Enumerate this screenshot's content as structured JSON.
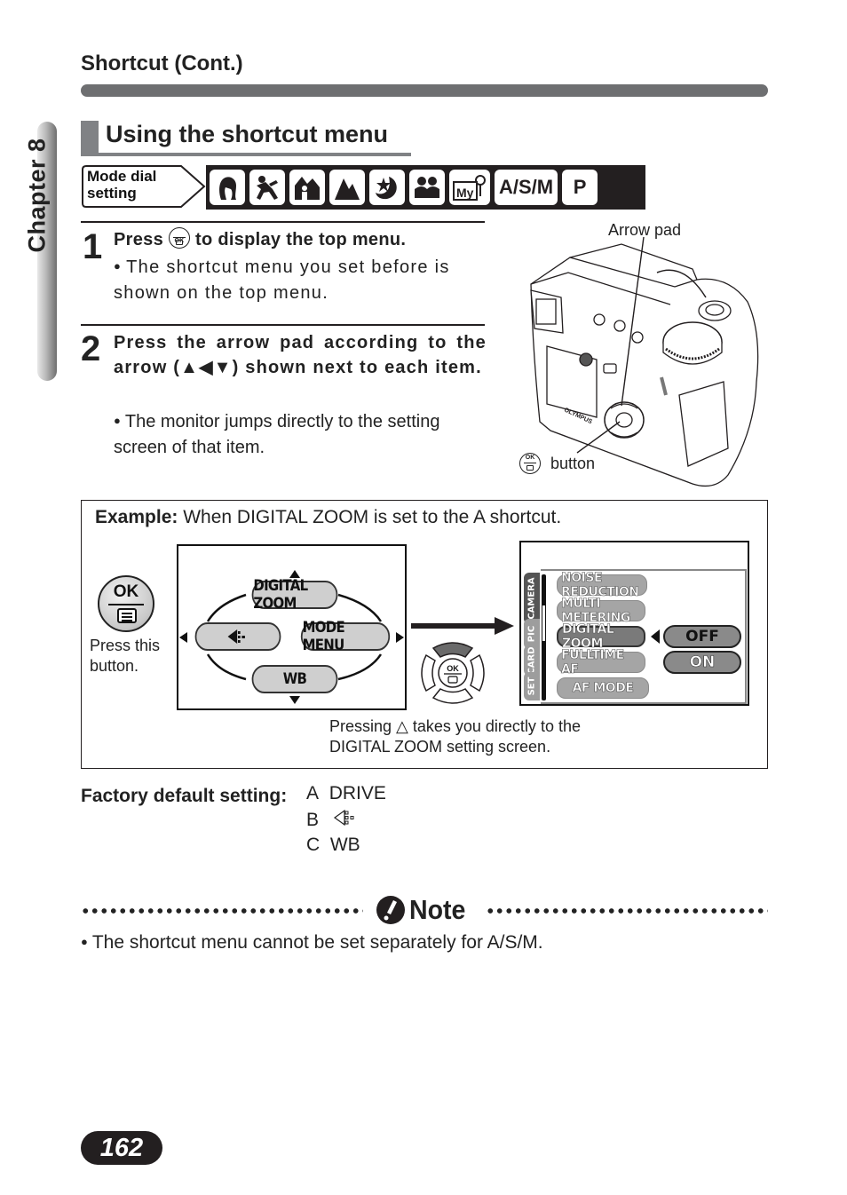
{
  "chapter_tab": {
    "label": "Chapter 8"
  },
  "header": {
    "section": "Shortcut (Cont.)"
  },
  "title": "Using the shortcut menu",
  "mode_dial": {
    "label_line1": "Mode dial",
    "label_line2": "setting",
    "modes": [
      {
        "icon": "portrait-icon",
        "text": ""
      },
      {
        "icon": "sports-icon",
        "text": ""
      },
      {
        "icon": "landscape-portrait-icon",
        "text": ""
      },
      {
        "icon": "landscape-icon",
        "text": ""
      },
      {
        "icon": "night-scene-icon",
        "text": ""
      },
      {
        "icon": "self-portrait-icon",
        "text": ""
      },
      {
        "icon": "my-mode-icon",
        "text": ""
      },
      {
        "icon": "asm-mode",
        "text": "A/S/M"
      },
      {
        "icon": "program-mode",
        "text": "P"
      }
    ]
  },
  "steps": [
    {
      "number": "1",
      "title_before": "Press",
      "title_after": "to display the top menu.",
      "bullet": "The shortcut menu you set before is shown on the top menu."
    },
    {
      "number": "2",
      "title": "Press the arrow pad according to the arrow (▲◀▼) shown next to each item.",
      "bullet": "The monitor jumps directly to the setting screen of that item."
    }
  ],
  "camera_illustration": {
    "arrow_pad_label": "Arrow pad",
    "button_label": "button",
    "brand": "OLYMPUS"
  },
  "example": {
    "label": "Example:",
    "text": "When DIGITAL ZOOM is set to the A shortcut.",
    "ok_button": {
      "text": "OK",
      "caption_line1": "Press this",
      "caption_line2": "button."
    },
    "top_menu": {
      "up": "DIGITAL ZOOM",
      "left": "",
      "right": "MODE MENU",
      "down": "WB"
    },
    "setting_screen": {
      "tabs": [
        "CAMERA",
        "PIC",
        "CARD",
        "SET"
      ],
      "items": [
        "NOISE REDUCTION",
        "MULTI METERING",
        "DIGITAL ZOOM",
        "FULLTIME AF",
        "AF MODE"
      ],
      "selected_item": "DIGITAL ZOOM",
      "options": [
        "OFF",
        "ON"
      ],
      "selected_option": "OFF"
    },
    "caption_line1": "Pressing △ takes you directly to the",
    "caption_line2": "DIGITAL ZOOM setting screen."
  },
  "factory_default": {
    "label": "Factory default setting:",
    "rows": [
      {
        "key": "A",
        "value": "DRIVE"
      },
      {
        "key": "B",
        "value": "",
        "icon": "flash-mode-icon"
      },
      {
        "key": "C",
        "value": "WB"
      }
    ]
  },
  "note": {
    "title": "Note",
    "bullet": "The shortcut menu cannot be set separately for A/S/M."
  },
  "page_number": "162"
}
